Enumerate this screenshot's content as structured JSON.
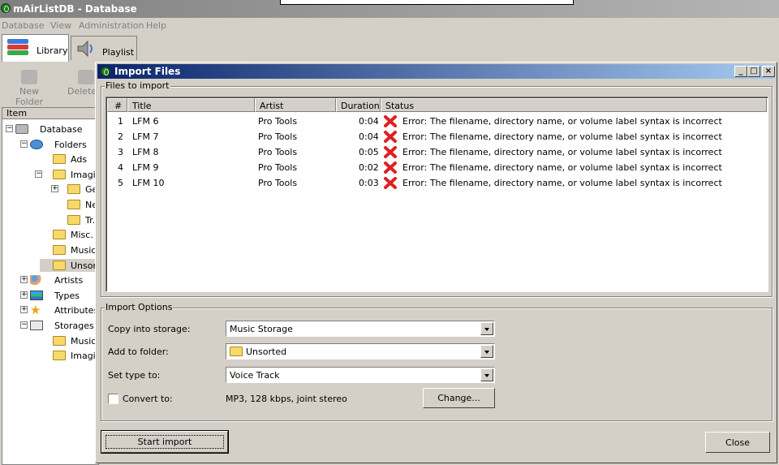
{
  "app": {
    "title": "mAirListDB - Database",
    "menu": [
      "Database",
      "View",
      "Administration",
      "Help"
    ],
    "tabs": [
      {
        "label": "Library"
      },
      {
        "label": "Playlist"
      }
    ],
    "toolbar": [
      "New Folder",
      "Delete F"
    ],
    "tree_header": "Item",
    "tree": [
      {
        "label": "Database",
        "icon": "database-icon"
      },
      {
        "label": "Folders",
        "icon": "folders-icon"
      },
      {
        "label": "Ads",
        "icon": "folder-icon"
      },
      {
        "label": "Imagir",
        "icon": "folder-icon"
      },
      {
        "label": "Ge",
        "icon": "folder-icon"
      },
      {
        "label": "Ne",
        "icon": "folder-icon"
      },
      {
        "label": "Tr.",
        "icon": "folder-icon"
      },
      {
        "label": "Misc. I",
        "icon": "folder-icon"
      },
      {
        "label": "Music",
        "icon": "folder-icon"
      },
      {
        "label": "Unsort",
        "icon": "folder-icon"
      },
      {
        "label": "Artists",
        "icon": "artists-icon"
      },
      {
        "label": "Types",
        "icon": "types-icon"
      },
      {
        "label": "Attributes",
        "icon": "star-icon"
      },
      {
        "label": "Storages",
        "icon": "storage-icon"
      },
      {
        "label": "Music",
        "icon": "folder-icon"
      },
      {
        "label": "Imagir",
        "icon": "folder-icon"
      }
    ]
  },
  "dialog": {
    "title": "Import Files",
    "window_buttons": [
      "_",
      "□",
      "×"
    ],
    "files_group": "Files to import",
    "columns": [
      "#",
      "Title",
      "Artist",
      "Duration",
      "Status"
    ],
    "files": [
      {
        "num": "1",
        "title": "LFM 6",
        "artist": "Pro Tools",
        "duration": "0:04",
        "status": "Error: The filename, directory name, or volume label syntax is incorrect"
      },
      {
        "num": "2",
        "title": "LFM 7",
        "artist": "Pro Tools",
        "duration": "0:04",
        "status": "Error: The filename, directory name, or volume label syntax is incorrect"
      },
      {
        "num": "3",
        "title": "LFM 8",
        "artist": "Pro Tools",
        "duration": "0:05",
        "status": "Error: The filename, directory name, or volume label syntax is incorrect"
      },
      {
        "num": "4",
        "title": "LFM 9",
        "artist": "Pro Tools",
        "duration": "0:02",
        "status": "Error: The filename, directory name, or volume label syntax is incorrect"
      },
      {
        "num": "5",
        "title": "LFM 10",
        "artist": "Pro Tools",
        "duration": "0:03",
        "status": "Error: The filename, directory name, or volume label syntax is incorrect"
      }
    ],
    "options_group": "Import Options",
    "copy_label": "Copy into storage:",
    "copy_value": "Music Storage",
    "folder_label": "Add to folder:",
    "folder_value": "Unsorted",
    "type_label": "Set type to:",
    "type_value": "Voice Track",
    "convert_label": "Convert to:",
    "convert_checked": false,
    "convert_value": "MP3, 128 kbps, joint stereo",
    "change_button": "Change...",
    "start_button": "Start import",
    "close_button": "Close"
  },
  "colors": {
    "active_titlebar": "#0a246a",
    "inactive_titlebar": "#808080",
    "face": "#d4d0c8",
    "error": "#e02020"
  }
}
